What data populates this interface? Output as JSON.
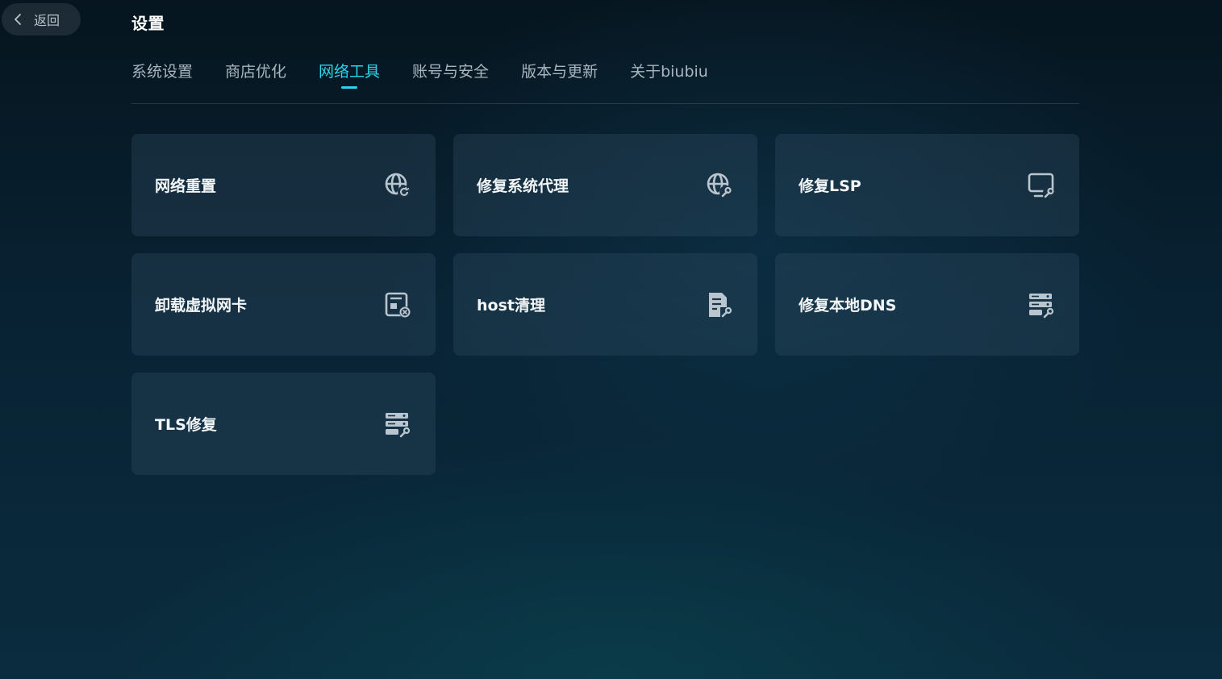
{
  "back": {
    "label": "返回",
    "icon": "chevron-left-icon"
  },
  "page": {
    "title": "设置"
  },
  "tabs": [
    {
      "label": "系统设置",
      "active": false
    },
    {
      "label": "商店优化",
      "active": false
    },
    {
      "label": "网络工具",
      "active": true
    },
    {
      "label": "账号与安全",
      "active": false
    },
    {
      "label": "版本与更新",
      "active": false
    },
    {
      "label": "关于biubiu",
      "active": false
    }
  ],
  "cards": [
    {
      "label": "网络重置",
      "icon": "globe-refresh-icon"
    },
    {
      "label": "修复系统代理",
      "icon": "globe-wrench-icon"
    },
    {
      "label": "修复LSP",
      "icon": "monitor-wrench-icon"
    },
    {
      "label": "卸载虚拟网卡",
      "icon": "network-card-remove-icon"
    },
    {
      "label": "host清理",
      "icon": "document-wrench-icon"
    },
    {
      "label": "修复本地DNS",
      "icon": "server-wrench-icon"
    },
    {
      "label": "TLS修复",
      "icon": "server-wrench-icon"
    }
  ],
  "colors": {
    "accent": "#2ad4ea",
    "card_bg": "#1b3345",
    "icon": "#b9c6cf"
  }
}
